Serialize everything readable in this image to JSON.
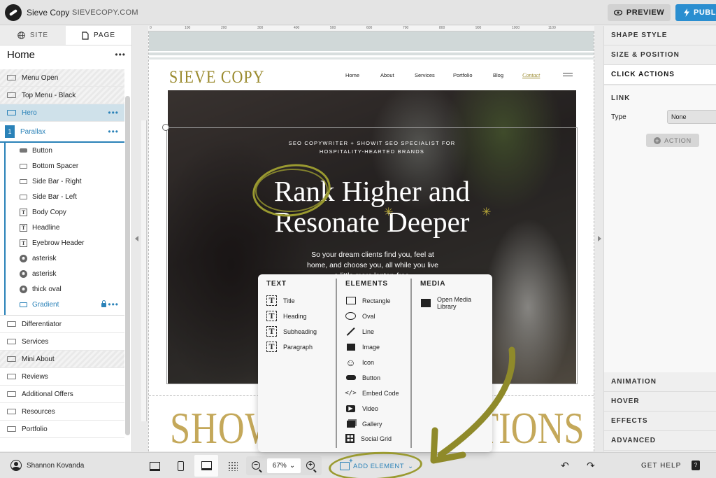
{
  "topbar": {
    "site_name": "Sieve Copy",
    "site_url": "SIEVECOPY.COM",
    "preview_label": "PREVIEW",
    "publish_label": "PUBL"
  },
  "left_panel": {
    "tabs": [
      {
        "label": "SITE",
        "icon": "globe-icon"
      },
      {
        "label": "PAGE",
        "icon": "page-icon"
      }
    ],
    "page_title": "Home",
    "page_menu": "•••",
    "sections_top": [
      {
        "label": "Menu Open",
        "hatched": true
      },
      {
        "label": "Top Menu - Black",
        "hatched": true
      },
      {
        "label": "Hero",
        "selected": true,
        "menu": "•••"
      }
    ],
    "parallax": {
      "badge": "1",
      "label": "Parallax",
      "menu": "•••"
    },
    "children": [
      {
        "label": "Button",
        "icon": "button-icon"
      },
      {
        "label": "Bottom Spacer",
        "icon": "box-icon"
      },
      {
        "label": "Side Bar - Right",
        "icon": "box-icon"
      },
      {
        "label": "Side Bar - Left",
        "icon": "box-icon"
      },
      {
        "label": "Body Copy",
        "icon": "text-icon",
        "glyph": "T"
      },
      {
        "label": "Headline",
        "icon": "text-icon",
        "glyph": "T"
      },
      {
        "label": "Eyebrow Header",
        "icon": "text-icon",
        "glyph": "T"
      },
      {
        "label": "asterisk",
        "icon": "shape-icon"
      },
      {
        "label": "asterisk",
        "icon": "shape-icon"
      },
      {
        "label": "thick oval",
        "icon": "shape-icon"
      },
      {
        "label": "Gradient",
        "icon": "box-icon",
        "locked": true,
        "menu": "•••"
      }
    ],
    "sections_bottom": [
      {
        "label": "Differentiator"
      },
      {
        "label": "Services"
      },
      {
        "label": "Mini About",
        "hatched": true
      },
      {
        "label": "Reviews"
      },
      {
        "label": "Additional Offers"
      },
      {
        "label": "Resources"
      },
      {
        "label": "Portfolio"
      }
    ]
  },
  "canvas": {
    "ruler_marks": [
      "0",
      "100",
      "200",
      "300",
      "400",
      "500",
      "600",
      "700",
      "800",
      "900",
      "1000",
      "1100"
    ],
    "site_logo": "SIEVE COPY",
    "nav": [
      "Home",
      "About",
      "Services",
      "Portfolio",
      "Blog",
      "Contact"
    ],
    "eyebrow_line1": "SEO COPYWRITER + SHOWIT SEO SPECIALIST FOR",
    "eyebrow_line2": "HOSPITALITY-HEARTED BRANDS",
    "headline_line1": "Rank Higher and",
    "headline_line2": "Resonate Deeper",
    "body_line1": "So your dream clients find you, feel at",
    "body_line2": "home, and choose you, all while you live",
    "body_line3": "a little more laptop-free.",
    "big_text_left": "SHOW",
    "big_text_right": "ATIONS",
    "accent_color": "#9a9a30"
  },
  "add_element_menu": {
    "text": {
      "title": "TEXT",
      "items": [
        "Title",
        "Heading",
        "Subheading",
        "Paragraph"
      ]
    },
    "elements": {
      "title": "ELEMENTS",
      "items": [
        {
          "label": "Rectangle",
          "icon": "rectangle-icon"
        },
        {
          "label": "Oval",
          "icon": "oval-icon"
        },
        {
          "label": "Line",
          "icon": "line-icon"
        },
        {
          "label": "Image",
          "icon": "image-icon"
        },
        {
          "label": "Icon",
          "icon": "smiley-icon"
        },
        {
          "label": "Button",
          "icon": "button-icon"
        },
        {
          "label": "Embed Code",
          "icon": "code-icon"
        },
        {
          "label": "Video",
          "icon": "video-icon"
        },
        {
          "label": "Gallery",
          "icon": "gallery-icon"
        },
        {
          "label": "Social Grid",
          "icon": "grid-icon"
        }
      ]
    },
    "media": {
      "title": "MEDIA",
      "item_line1": "Open Media",
      "item_line2": "Library"
    }
  },
  "right_panel": {
    "tabs": [
      "SHAPE STYLE",
      "SIZE & POSITION",
      "CLICK ACTIONS"
    ],
    "link_title": "LINK",
    "type_label": "Type",
    "type_value": "None",
    "action_label": "ACTION",
    "bottom_tabs": [
      "ANIMATION",
      "HOVER",
      "EFFECTS",
      "ADVANCED"
    ]
  },
  "bottombar": {
    "user_name": "Shannon Kovanda",
    "zoom": "67%",
    "zoom_caret": "⌄",
    "add_element": "ADD ELEMENT",
    "get_help": "GET HELP",
    "undo": "↶",
    "redo": "↷"
  }
}
